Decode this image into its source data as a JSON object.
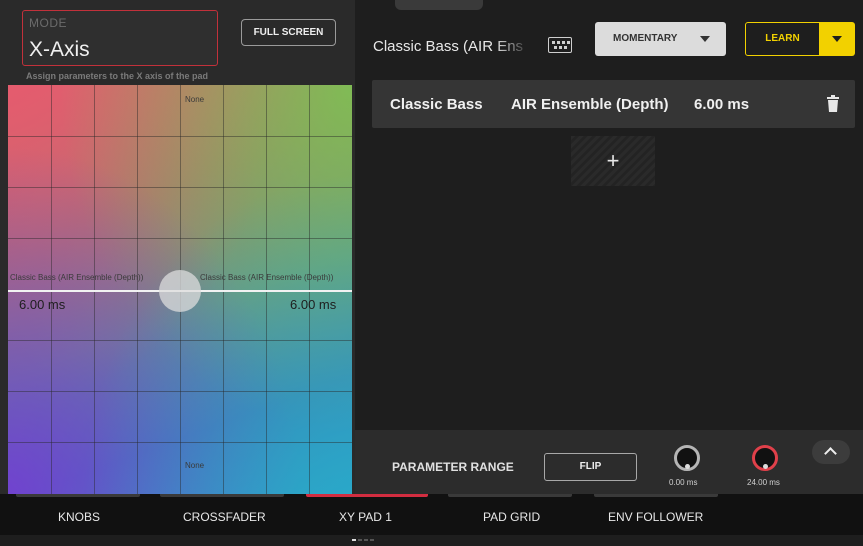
{
  "left": {
    "mode_label": "MODE",
    "mode_value": "X-Axis",
    "fullscreen_label": "FULL SCREEN",
    "hint": "Assign parameters to the X axis of the pad"
  },
  "pad": {
    "top_label": "None",
    "bottom_label": "None",
    "left_param": "Classic Bass (AIR Ensemble (Depth))",
    "right_param": "Classic Bass (AIR Ensemble (Depth))",
    "left_value": "6.00 ms",
    "right_value": "6.00 ms"
  },
  "right": {
    "preset_name": "Classic Bass (AIR Ens",
    "momentary_label": "MOMENTARY",
    "learn_label": "LEARN",
    "assignment": {
      "col1": "Classic Bass",
      "col2": "AIR Ensemble (Depth)",
      "col3": "6.00 ms"
    },
    "add_label": "+",
    "param_range": {
      "title": "PARAMETER RANGE",
      "flip_label": "FLIP",
      "min_value": "0.00 ms",
      "max_value": "24.00 ms"
    }
  },
  "tabs": [
    {
      "label": "KNOBS",
      "active": false
    },
    {
      "label": "CROSSFADER",
      "active": false
    },
    {
      "label": "XY PAD 1",
      "active": true
    },
    {
      "label": "PAD GRID",
      "active": false
    },
    {
      "label": "ENV FOLLOWER",
      "active": false
    }
  ],
  "colors": {
    "accent_red": "#d22d40",
    "learn_yellow": "#f2d100"
  }
}
